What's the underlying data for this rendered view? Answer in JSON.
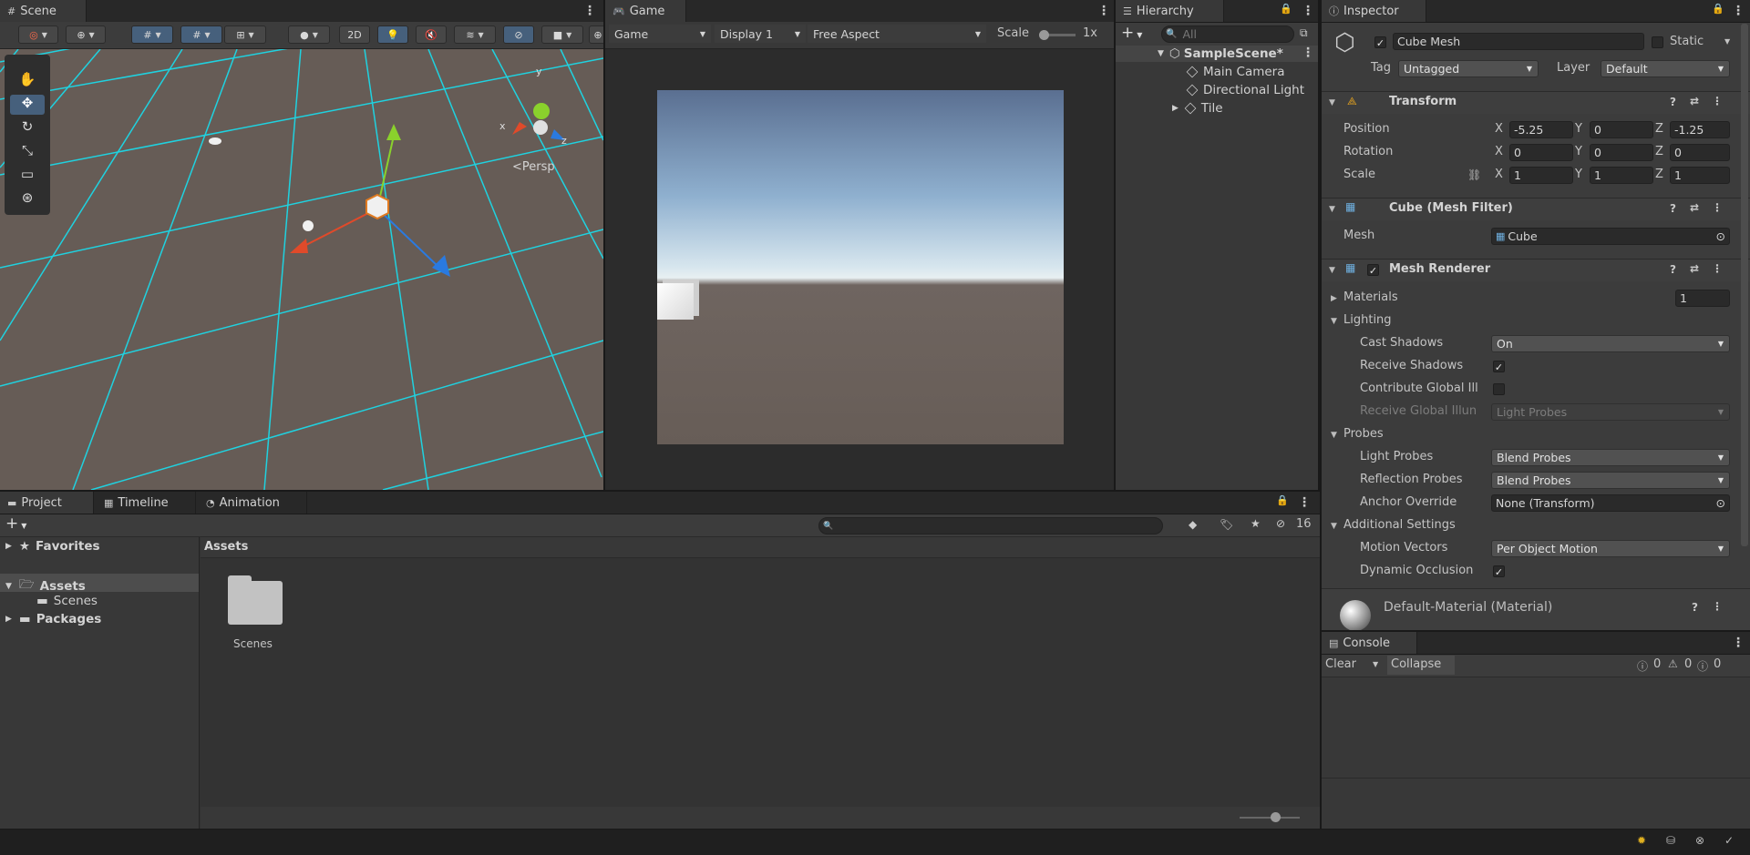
{
  "scene": {
    "tab": "Scene",
    "btn_2d": "2D",
    "gizmo": {
      "x": "x",
      "y": "y",
      "z": "z",
      "persp": "<Persp"
    }
  },
  "game": {
    "tab": "Game",
    "mode": "Game",
    "display": "Display 1",
    "aspect": "Free Aspect",
    "scale_label": "Scale",
    "scale_value": "1x"
  },
  "hierarchy": {
    "tab": "Hierarchy",
    "search_placeholder": "All",
    "items": [
      {
        "label": "SampleScene*"
      },
      {
        "label": "Main Camera"
      },
      {
        "label": "Directional Light"
      },
      {
        "label": "Tile"
      }
    ]
  },
  "inspector": {
    "tab": "Inspector",
    "object_name": "Cube Mesh",
    "static_label": "Static",
    "tag_label": "Tag",
    "tag_value": "Untagged",
    "layer_label": "Layer",
    "layer_value": "Default",
    "transform": {
      "title": "Transform",
      "position_label": "Position",
      "rotation_label": "Rotation",
      "scale_label": "Scale",
      "axes": {
        "x": "X",
        "y": "Y",
        "z": "Z"
      },
      "position": [
        "-5.25",
        "0",
        "-1.25"
      ],
      "rotation": [
        "0",
        "0",
        "0"
      ],
      "scale": [
        "1",
        "1",
        "1"
      ]
    },
    "mesh_filter": {
      "title": "Cube (Mesh Filter)",
      "mesh_label": "Mesh",
      "mesh_value": "Cube"
    },
    "mesh_renderer": {
      "title": "Mesh Renderer",
      "materials_label": "Materials",
      "materials_count": "1",
      "lighting_label": "Lighting",
      "cast_shadows_label": "Cast Shadows",
      "cast_shadows_value": "On",
      "receive_shadows_label": "Receive Shadows",
      "contribute_gi_label": "Contribute Global Ill",
      "receive_gi_label": "Receive Global Illun",
      "receive_gi_value": "Light Probes",
      "probes_label": "Probes",
      "light_probes_label": "Light Probes",
      "light_probes_value": "Blend Probes",
      "reflection_probes_label": "Reflection Probes",
      "reflection_probes_value": "Blend Probes",
      "anchor_override_label": "Anchor Override",
      "anchor_override_value": "None (Transform)",
      "additional_label": "Additional Settings",
      "motion_vectors_label": "Motion Vectors",
      "motion_vectors_value": "Per Object Motion",
      "dynamic_occlusion_label": "Dynamic Occlusion"
    },
    "material": {
      "title": "Default-Material (Material)"
    }
  },
  "console": {
    "tab": "Console",
    "clear": "Clear",
    "collapse": "Collapse",
    "info_count": "0",
    "warn_count": "0",
    "error_count": "0"
  },
  "project": {
    "tabs": [
      "Project",
      "Timeline",
      "Animation"
    ],
    "favorites": "Favorites",
    "assets": "Assets",
    "scenes": "Scenes",
    "packages": "Packages",
    "breadcrumb": "Assets",
    "folder_label": "Scenes",
    "hidden_count": "16"
  },
  "colors": {
    "grid": "#1fd2e0",
    "accent": "#2c5d87"
  }
}
